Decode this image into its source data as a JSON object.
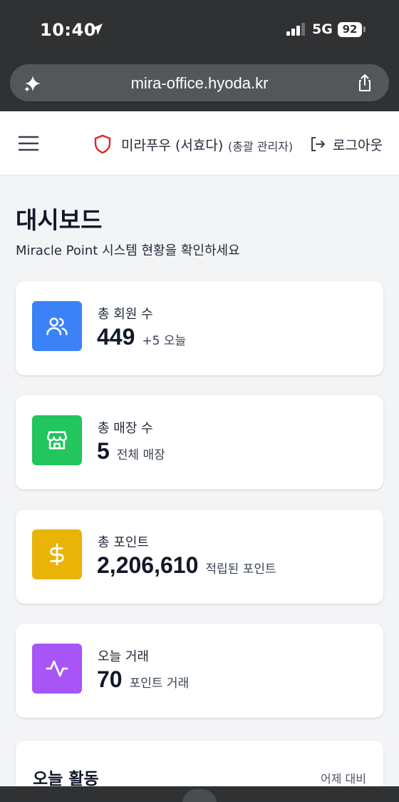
{
  "status_bar": {
    "time": "10:40",
    "network": "5G",
    "battery": "92"
  },
  "browser": {
    "url": "mira-office.hyoda.kr"
  },
  "header": {
    "user_name": "미라푸우 (서효다)",
    "user_role": "(총괄 관리자)",
    "logout_label": "로그아웃"
  },
  "page": {
    "title": "대시보드",
    "subtitle": "Miracle Point 시스템 현황을 확인하세요"
  },
  "stats": [
    {
      "label": "총 회원 수",
      "value": "449",
      "sub": "+5 오늘",
      "icon": "users-icon",
      "color": "#3b82f6"
    },
    {
      "label": "총 매장 수",
      "value": "5",
      "sub": "전체 매장",
      "icon": "store-icon",
      "color": "#22c55e"
    },
    {
      "label": "총 포인트",
      "value": "2,206,610",
      "sub": "적립된 포인트",
      "icon": "dollar-icon",
      "color": "#eab308"
    },
    {
      "label": "오늘 거래",
      "value": "70",
      "sub": "포인트 거래",
      "icon": "activity-icon",
      "color": "#a855f7"
    }
  ],
  "activity": {
    "title": "오늘 활동",
    "compare_label": "어제 대비"
  }
}
